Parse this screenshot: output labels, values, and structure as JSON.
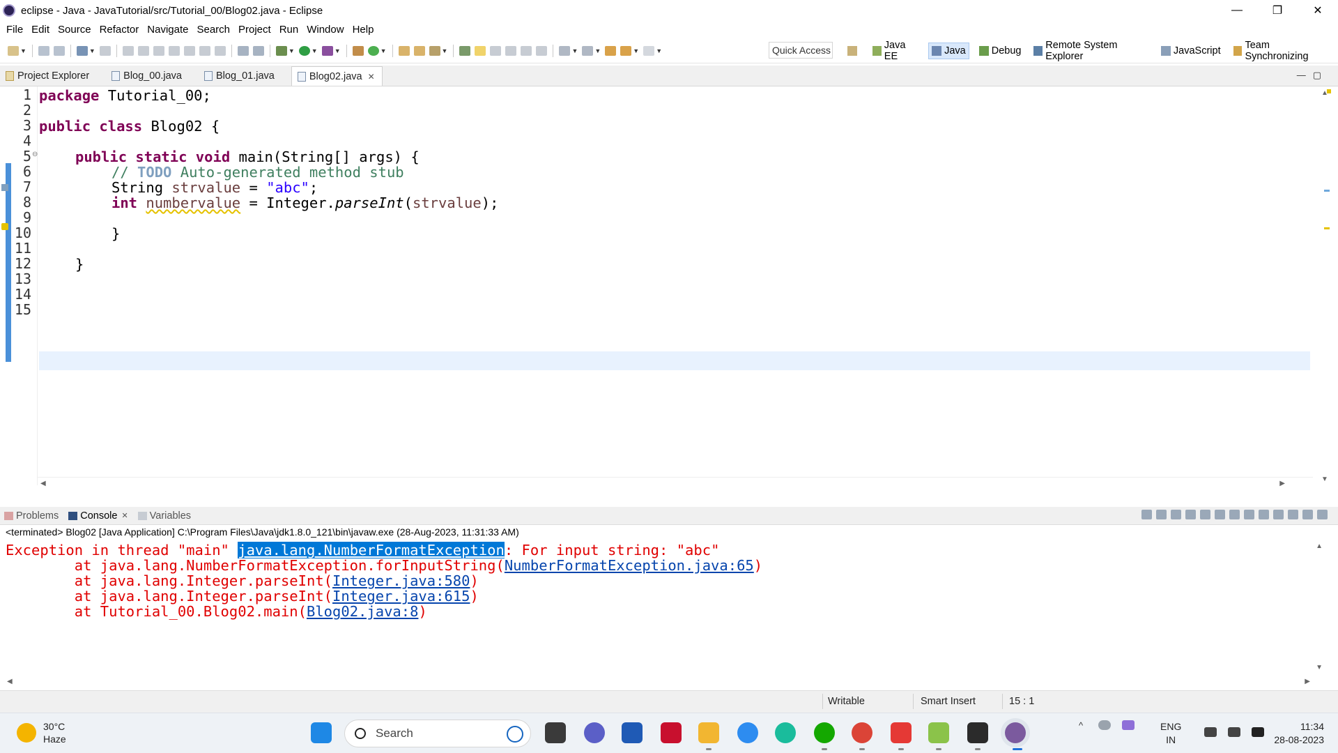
{
  "window": {
    "title": "eclipse - Java - JavaTutorial/src/Tutorial_00/Blog02.java - Eclipse",
    "minimize": "—",
    "restore": "❐",
    "close": "✕"
  },
  "menu": [
    "File",
    "Edit",
    "Source",
    "Refactor",
    "Navigate",
    "Search",
    "Project",
    "Run",
    "Window",
    "Help"
  ],
  "toolbar": {
    "quick_access": "Quick Access",
    "perspectives": [
      {
        "label": "Java EE",
        "icon": "java-ee-icon",
        "active": false
      },
      {
        "label": "Java",
        "icon": "java-icon",
        "active": true
      },
      {
        "label": "Debug",
        "icon": "debug-icon",
        "active": false
      },
      {
        "label": "Remote System Explorer",
        "icon": "remote-system-icon",
        "active": false
      },
      {
        "label": "JavaScript",
        "icon": "javascript-icon",
        "active": false
      },
      {
        "label": "Team Synchronizing",
        "icon": "team-sync-icon",
        "active": false
      }
    ]
  },
  "editor_tabs": [
    {
      "label": "Project Explorer",
      "active": false
    },
    {
      "label": "Blog_00.java",
      "active": false
    },
    {
      "label": "Blog_01.java",
      "active": false
    },
    {
      "label": "Blog02.java",
      "active": true
    }
  ],
  "editor": {
    "line_numbers": [
      "1",
      "2",
      "3",
      "4",
      "5",
      "6",
      "7",
      "8",
      "9",
      "10",
      "11",
      "12",
      "13",
      "14",
      "15"
    ],
    "code": {
      "l1_kw": "package",
      "l1_rest": " Tutorial_00;",
      "l3_kw": "public class",
      "l3_rest": " Blog02 {",
      "l5_kw": "public static void",
      "l5_rest": " main(String[] args) {",
      "l6_c1": "// ",
      "l6_todo": "TODO",
      "l6_c2": " Auto-generated method stub",
      "l7_a": "String ",
      "l7_var": "strvalue",
      "l7_b": " = ",
      "l7_str": "\"abc\"",
      "l7_c": ";",
      "l8_kw": "int",
      "l8_sp": " ",
      "l8_var": "numbervalue",
      "l8_b": " = Integer.",
      "l8_it": "parseInt",
      "l8_c": "(",
      "l8_var2": "strvalue",
      "l8_d": ");",
      "l10": "}",
      "l12": "}"
    }
  },
  "console": {
    "tabs": [
      {
        "label": "Problems",
        "active": false
      },
      {
        "label": "Console",
        "active": true
      },
      {
        "label": "Variables",
        "active": false
      }
    ],
    "header": "<terminated> Blog02 [Java Application] C:\\Program Files\\Java\\jdk1.8.0_121\\bin\\javaw.exe (28-Aug-2023, 11:31:33 AM)",
    "lines": {
      "e1_a": "Exception in thread \"main\" ",
      "e1_sel": "java.lang.NumberFormatException",
      "e1_b": ": For input string: \"abc\"",
      "e2_a": "        at java.lang.NumberFormatException.forInputString(",
      "e2_link": "NumberFormatException.java:65",
      "e2_b": ")",
      "e3_a": "        at java.lang.Integer.parseInt(",
      "e3_link": "Integer.java:580",
      "e3_b": ")",
      "e4_a": "        at java.lang.Integer.parseInt(",
      "e4_link": "Integer.java:615",
      "e4_b": ")",
      "e5_a": "        at Tutorial_00.Blog02.main(",
      "e5_link": "Blog02.java:8",
      "e5_b": ")"
    }
  },
  "status": {
    "writable": "Writable",
    "insert_mode": "Smart Insert",
    "position": "15 : 1"
  },
  "taskbar": {
    "weather_temp": "30°C",
    "weather_desc": "Haze",
    "search_placeholder": "Search",
    "lang_top": "ENG",
    "lang_bottom": "IN",
    "time": "11:34",
    "date": "28-08-2023"
  },
  "colors": {
    "keyword": "#7f0055",
    "comment": "#3f7f5f",
    "string": "#2a00ff",
    "error_text": "#e00000",
    "link": "#0645ad",
    "selection": "#0078d7",
    "current_line": "#e8f2fe"
  }
}
